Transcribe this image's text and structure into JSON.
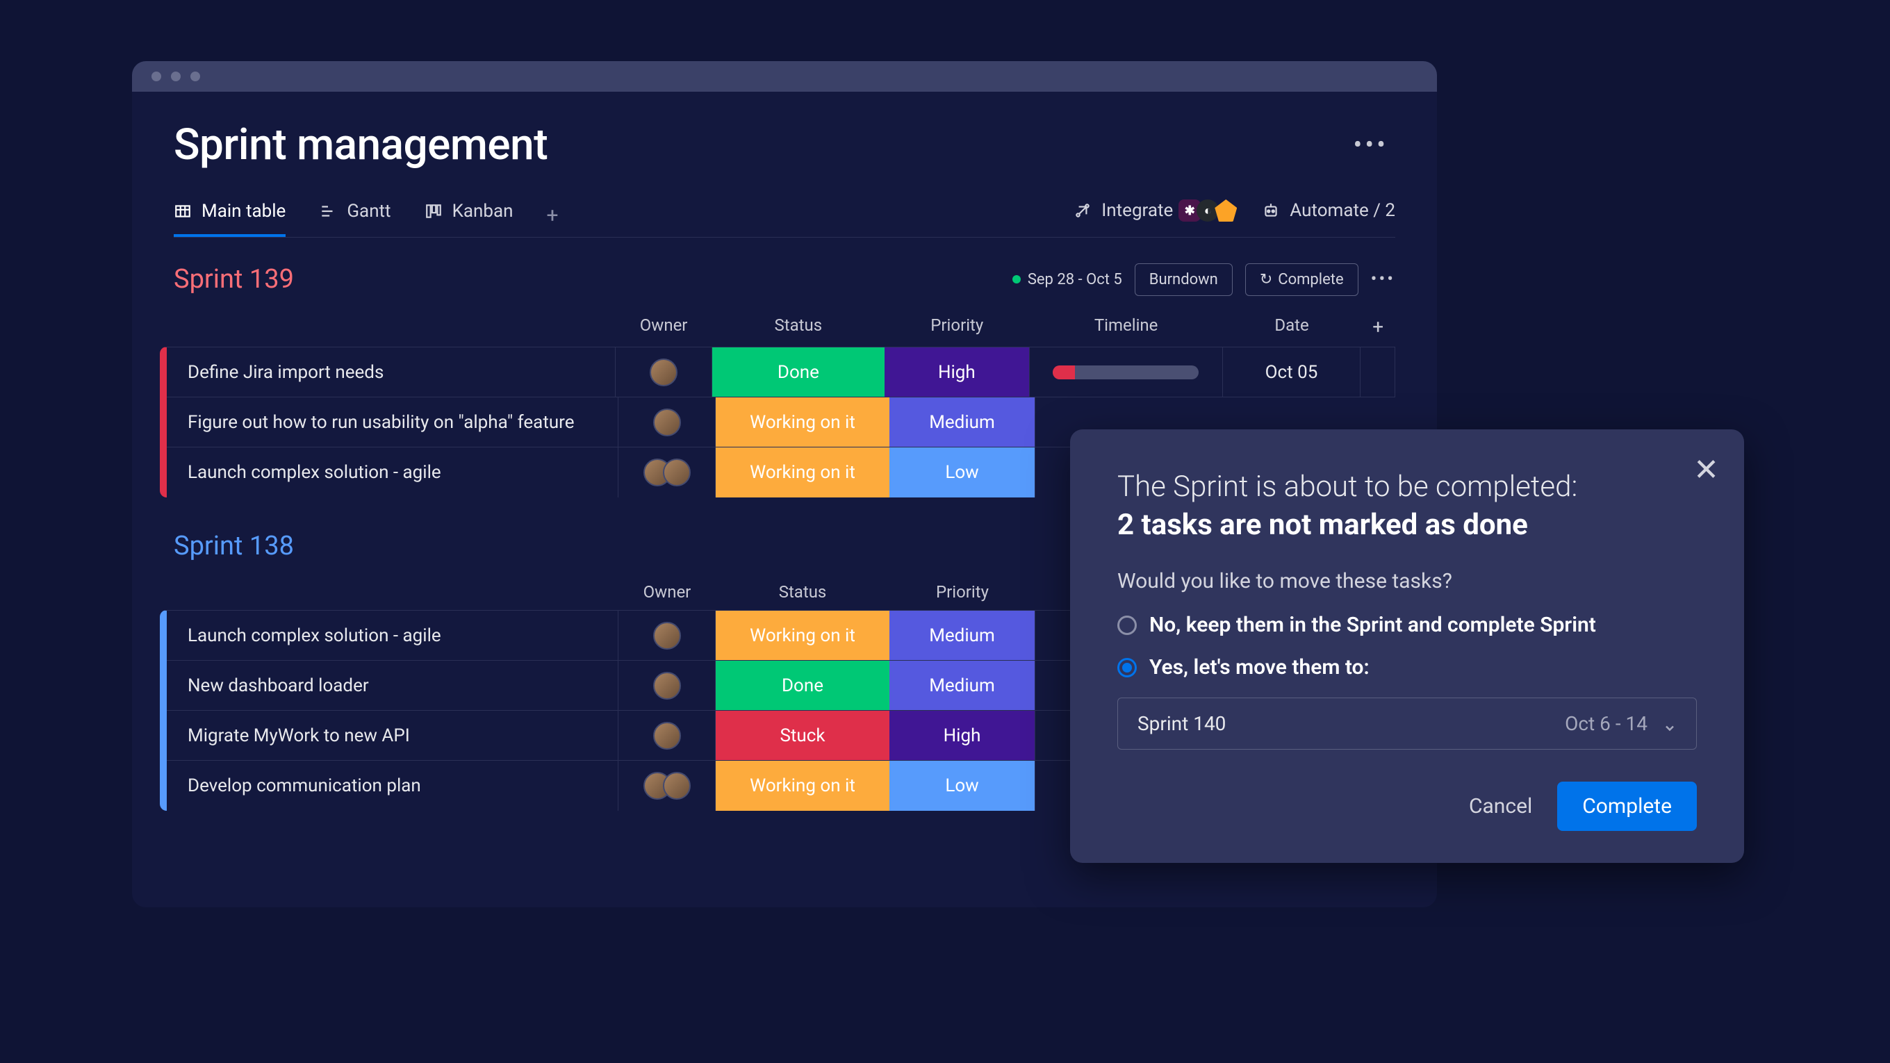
{
  "page": {
    "title": "Sprint management"
  },
  "views": {
    "tabs": [
      {
        "label": "Main table",
        "active": true,
        "icon": "table"
      },
      {
        "label": "Gantt",
        "active": false,
        "icon": "gantt"
      },
      {
        "label": "Kanban",
        "active": false,
        "icon": "kanban"
      }
    ],
    "integrate_label": "Integrate",
    "automate_label": "Automate / 2"
  },
  "groups": [
    {
      "title": "Sprint 139",
      "color": "#fb6e77",
      "date_range": "Sep 28 - Oct 5",
      "buttons": {
        "burndown": "Burndown",
        "complete": "Complete"
      },
      "show_meta": true,
      "columns": [
        "Owner",
        "Status",
        "Priority",
        "Timeline",
        "Date"
      ],
      "rows": [
        {
          "name": "Define Jira import needs",
          "owner_count": 1,
          "status": {
            "label": "Done",
            "class": "s-done"
          },
          "priority": {
            "label": "High",
            "class": "p-high"
          },
          "timeline_pct": 15,
          "date": "Oct 05"
        },
        {
          "name": "Figure out how to run usability on \"alpha\" feature",
          "owner_count": 1,
          "status": {
            "label": "Working on it",
            "class": "s-working"
          },
          "priority": {
            "label": "Medium",
            "class": "p-medium"
          },
          "timeline_pct": null,
          "date": ""
        },
        {
          "name": "Launch complex solution - agile",
          "owner_count": 2,
          "status": {
            "label": "Working on it",
            "class": "s-working"
          },
          "priority": {
            "label": "Low",
            "class": "p-low"
          },
          "timeline_pct": null,
          "date": ""
        }
      ]
    },
    {
      "title": "Sprint 138",
      "color": "#579bfc",
      "show_meta": false,
      "columns": [
        "Owner",
        "Status",
        "Priority"
      ],
      "rows": [
        {
          "name": "Launch complex solution - agile",
          "owner_count": 1,
          "status": {
            "label": "Working on it",
            "class": "s-working"
          },
          "priority": {
            "label": "Medium",
            "class": "p-medium"
          }
        },
        {
          "name": "New dashboard loader",
          "owner_count": 1,
          "status": {
            "label": "Done",
            "class": "s-done"
          },
          "priority": {
            "label": "Medium",
            "class": "p-medium"
          }
        },
        {
          "name": "Migrate MyWork to new API",
          "owner_count": 1,
          "status": {
            "label": "Stuck",
            "class": "s-stuck"
          },
          "priority": {
            "label": "High",
            "class": "p-high"
          }
        },
        {
          "name": "Develop communication plan",
          "owner_count": 2,
          "status": {
            "label": "Working on it",
            "class": "s-working"
          },
          "priority": {
            "label": "Low",
            "class": "p-low"
          }
        }
      ]
    }
  ],
  "modal": {
    "heading_line1": "The Sprint is about to be completed:",
    "heading_line2": "2 tasks are not marked as done",
    "prompt": "Would you like to move these tasks?",
    "option_no": "No, keep them in the Sprint and complete Sprint",
    "option_yes": "Yes, let's move them to:",
    "selected": "yes",
    "select": {
      "value": "Sprint 140",
      "date": "Oct 6 - 14"
    },
    "cancel": "Cancel",
    "complete": "Complete"
  }
}
